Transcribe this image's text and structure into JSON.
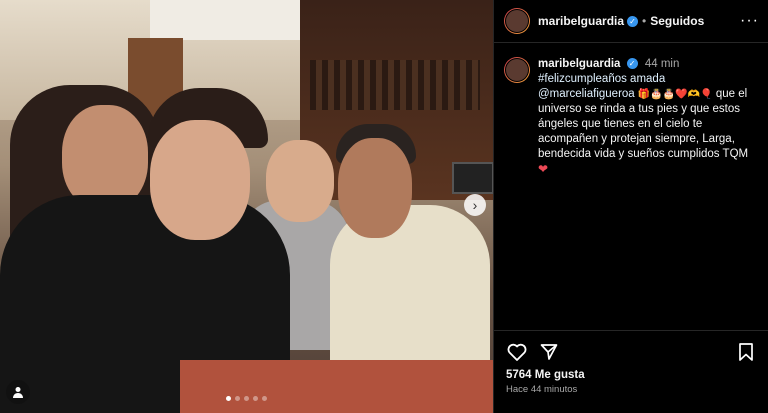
{
  "post": {
    "username": "maribelguardia",
    "follow_status": "Seguidos",
    "caption": {
      "username": "maribelguardia",
      "time": "44 min",
      "hashtag": "#felizcumpleaños amada",
      "mention": "@marceliafigueroa",
      "emojis_1": "🎁🎂🎂❤️🫶🎈",
      "text_1": "que el universo se rinda a tus pies y que estos ángeles que tienes en el cielo te acompañen y protejan siempre, Larga, bendecida vida y sueños cumplidos TQM",
      "emoji_end": "❤"
    },
    "likes": "5764 Me gusta",
    "posted_ago": "Hace 44 minutos"
  },
  "icons": {
    "more": "more-options-icon",
    "like": "heart-icon",
    "share": "share-icon",
    "save": "bookmark-icon",
    "next": "chevron-right-icon",
    "tag": "user-tag-icon"
  },
  "colors": {
    "verified": "#3897f0",
    "background": "#000000",
    "muted": "#a8a8a8"
  }
}
